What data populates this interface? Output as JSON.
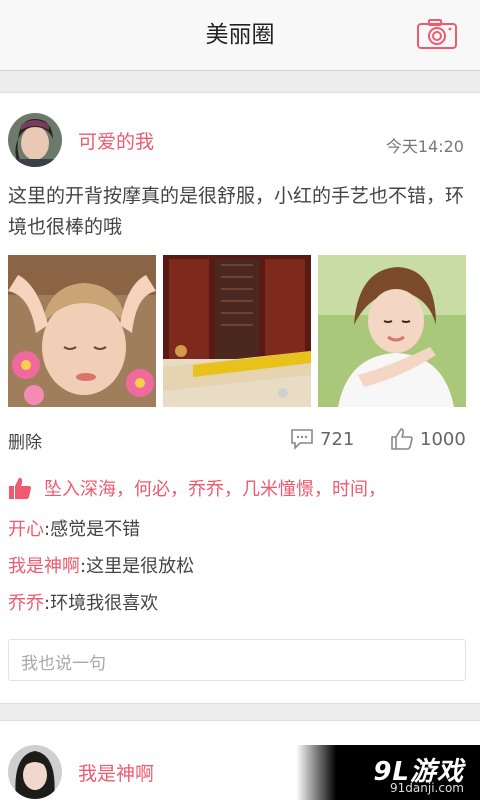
{
  "header": {
    "title": "美丽圈",
    "camera_icon": "camera-icon"
  },
  "colors": {
    "accent": "#ef5a6f",
    "bg": "#ededed"
  },
  "post": {
    "username": "可爱的我",
    "time": "今天14:20",
    "text": "这里的开背按摩真的是很舒服，小红的手艺也不错，环境也很棒的哦",
    "photos": [
      "facial-massage-photo",
      "spa-room-photo",
      "smiling-woman-photo"
    ],
    "delete_label": "删除",
    "comment_count": "721",
    "like_count": "1000",
    "likers": "坠入深海，何必，乔乔，几米憧憬，时间，",
    "comments": [
      {
        "author": "开心",
        "separator": ":",
        "text": "感觉是不错"
      },
      {
        "author": "我是神啊",
        "separator": ":",
        "text": "这里是很放松"
      },
      {
        "author": "乔乔",
        "separator": ":",
        "text": "环境我很喜欢"
      }
    ],
    "reply_placeholder": "我也说一句"
  },
  "next_post": {
    "username": "我是神啊"
  },
  "watermark": {
    "logo": "9L游戏",
    "url": "91danji.com"
  }
}
